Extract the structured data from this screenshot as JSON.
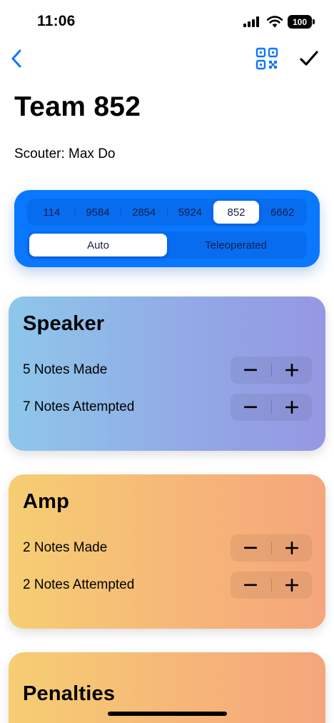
{
  "status_bar": {
    "time": "11:06",
    "battery": "100"
  },
  "nav": {
    "back_icon": "chevron-left-icon",
    "qr_icon": "qr-code-icon",
    "done_icon": "checkmark-icon",
    "accent": "#0a77ff"
  },
  "header": {
    "title": "Team 852",
    "scouter": "Scouter: Max Do"
  },
  "team_selector": {
    "teams": [
      "114",
      "9584",
      "2854",
      "5924",
      "852",
      "6662"
    ],
    "selected": "852"
  },
  "mode_selector": {
    "modes": [
      "Auto",
      "Teleoperated"
    ],
    "selected": "Auto"
  },
  "cards": {
    "speaker": {
      "title": "Speaker",
      "rows": [
        {
          "label": "5 Notes Made"
        },
        {
          "label": "7 Notes Attempted"
        }
      ]
    },
    "amp": {
      "title": "Amp",
      "rows": [
        {
          "label": "2 Notes Made"
        },
        {
          "label": "2 Notes Attempted"
        }
      ]
    },
    "penalties": {
      "title": "Penalties"
    }
  },
  "stepper": {
    "minus_icon": "minus-icon",
    "plus_icon": "plus-icon"
  },
  "colors": {
    "panel_blue": "#0a77ff",
    "speaker_start": "#8ec7ea",
    "speaker_end": "#9598e2",
    "amp_start": "#f6ce72",
    "amp_end": "#f5a67b"
  }
}
